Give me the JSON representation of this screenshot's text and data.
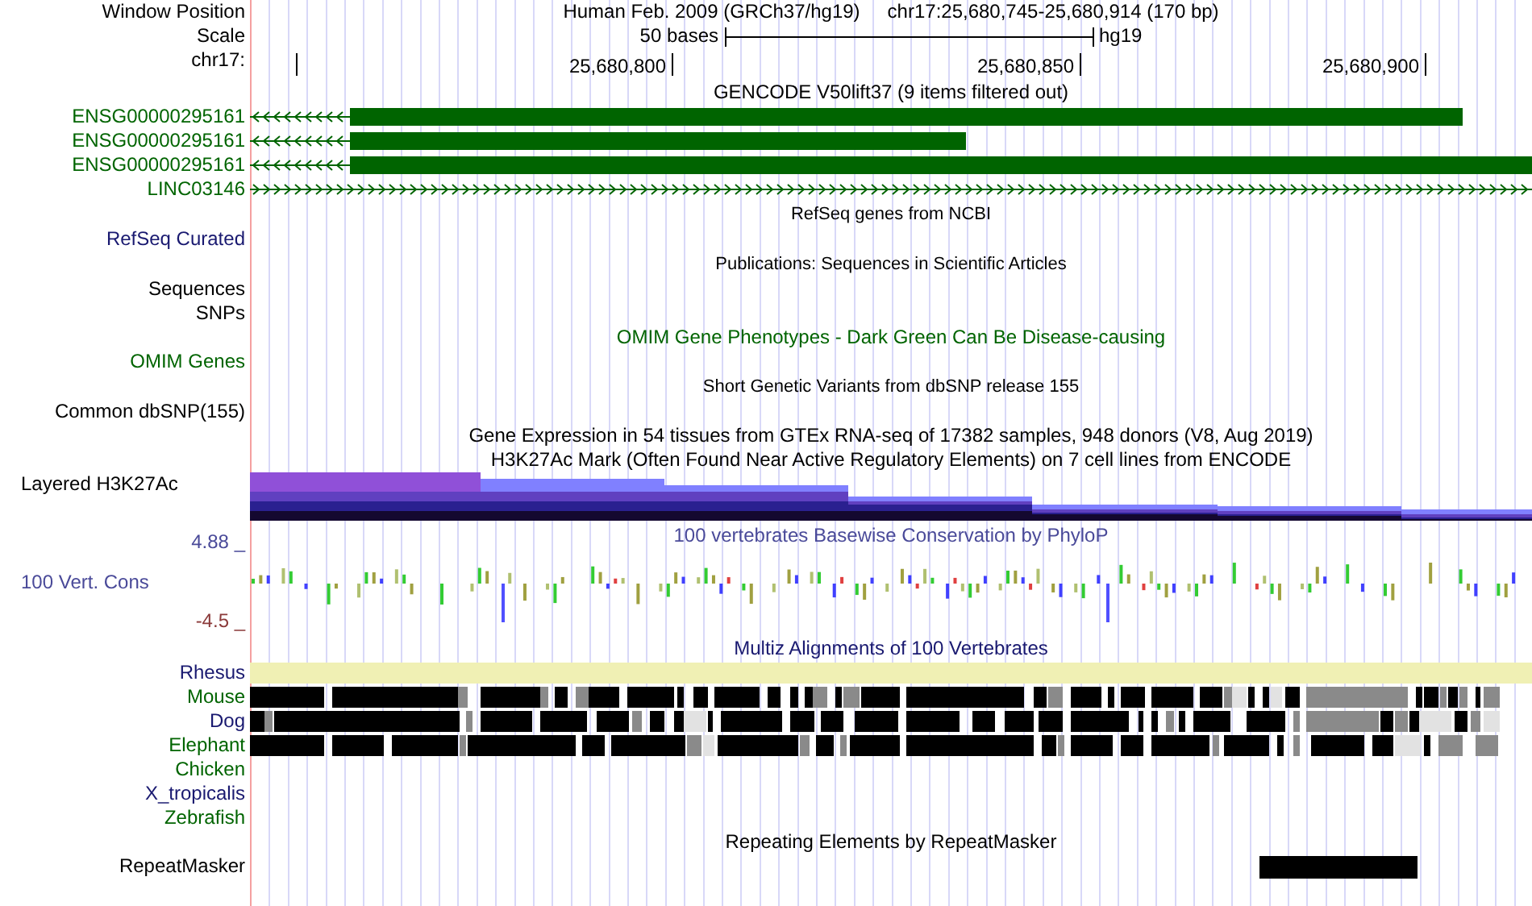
{
  "header": {
    "position_label": "Window Position",
    "scale_label": "Scale",
    "chrom_label": "chr17:",
    "title": "Human Feb. 2009 (GRCh37/hg19)",
    "position": "chr17:25,680,745-25,680,914 (170 bp)",
    "scale_text": "50 bases",
    "assembly": "hg19",
    "ticks": [
      "25,680,800",
      "25,680,850",
      "25,680,900"
    ]
  },
  "tracks": [
    {
      "kind": "title",
      "text": "GENCODE V50lift37 (9 items filtered out)",
      "color": "#000000"
    },
    {
      "kind": "gene_reverse",
      "label": "ENSG00000295161",
      "color": "#006400"
    },
    {
      "kind": "gene_reverse",
      "label": "ENSG00000295161",
      "color": "#006400"
    },
    {
      "kind": "gene_reverse",
      "label": "ENSG00000295161",
      "color": "#006400"
    },
    {
      "kind": "gene_forward",
      "label": "LINC03146",
      "color": "#006400"
    },
    {
      "kind": "small_title",
      "text": "RefSeq genes from NCBI"
    },
    {
      "kind": "label",
      "label": "RefSeq Curated",
      "color": "#191970"
    },
    {
      "kind": "small_title",
      "text": "Publications: Sequences in Scientific Articles"
    },
    {
      "kind": "label",
      "label": "Sequences",
      "color": "#000000"
    },
    {
      "kind": "label",
      "label": "SNPs",
      "color": "#000000"
    },
    {
      "kind": "title",
      "text": "OMIM Gene Phenotypes - Dark Green Can Be Disease-causing",
      "color": "#006400"
    },
    {
      "kind": "label",
      "label": "OMIM Genes",
      "color": "#006400"
    },
    {
      "kind": "small_title",
      "text": "Short Genetic Variants from dbSNP release 155"
    },
    {
      "kind": "label",
      "label": "Common dbSNP(155)",
      "color": "#000000"
    },
    {
      "kind": "title",
      "text": "Gene Expression in 54 tissues from GTEx RNA-seq of 17382 samples, 948 donors (V8, Aug 2019)",
      "color": "#000000"
    },
    {
      "kind": "title",
      "text": "H3K27Ac Mark (Often Found Near Active Regulatory Elements) on 7 cell lines from ENCODE",
      "color": "#000000"
    },
    {
      "kind": "layered",
      "label": "Layered H3K27Ac"
    },
    {
      "kind": "conservation",
      "title": "100 vertebrates Basewise Conservation by PhyloP",
      "label": "100 Vert. Cons",
      "max": "4.88 _",
      "min": "-4.5 _"
    },
    {
      "kind": "title",
      "text": "Multiz Alignments of 100 Vertebrates",
      "color": "#191970"
    },
    {
      "kind": "species_full",
      "label": "Rhesus",
      "color": "#191970"
    },
    {
      "kind": "species_blocks",
      "label": "Mouse",
      "color": "#006400"
    },
    {
      "kind": "species_blocks",
      "label": "Dog",
      "color": "#191970"
    },
    {
      "kind": "species_blocks",
      "label": "Elephant",
      "color": "#006400"
    },
    {
      "kind": "species_none",
      "label": "Chicken",
      "color": "#006400"
    },
    {
      "kind": "species_none",
      "label": "X_tropicalis",
      "color": "#191970"
    },
    {
      "kind": "species_none",
      "label": "Zebrafish",
      "color": "#006400"
    },
    {
      "kind": "title",
      "text": "Repeating Elements by RepeatMasker",
      "color": "#000000"
    },
    {
      "kind": "repeat",
      "label": "RepeatMasker"
    }
  ]
}
